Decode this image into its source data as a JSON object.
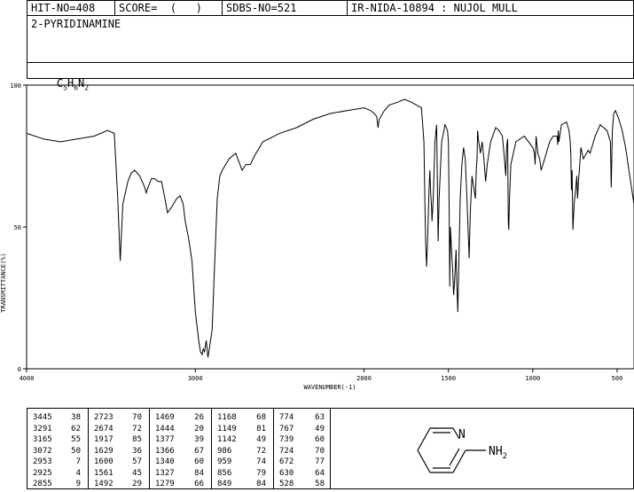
{
  "header": {
    "hit_no": "HIT-NO=408",
    "score": "SCORE=  (   )",
    "sdbs_no": "SDBS-NO=521",
    "ir_info": "IR-NIDA-10894 : NUJOL MULL",
    "compound_name": "2-PYRIDINAMINE",
    "formula": {
      "c": "C",
      "c_n": "5",
      "h": "H",
      "h_n": "6",
      "n": "N",
      "n_n": "2"
    }
  },
  "chart_data": {
    "type": "line",
    "xlabel": "WAVENUMBER(-1)",
    "ylabel": "TRANSMITTANCE(%)",
    "xlim": [
      4000,
      400
    ],
    "ylim": [
      0,
      100
    ],
    "x_ticks": [
      4000,
      3000,
      2000,
      1500,
      1000,
      500
    ],
    "y_ticks": [
      0,
      50,
      100
    ],
    "x": [
      4000,
      3900,
      3800,
      3700,
      3600,
      3520,
      3480,
      3460,
      3445,
      3430,
      3400,
      3380,
      3360,
      3330,
      3300,
      3291,
      3280,
      3260,
      3240,
      3220,
      3200,
      3180,
      3165,
      3140,
      3110,
      3090,
      3072,
      3060,
      3040,
      3020,
      3000,
      2980,
      2970,
      2960,
      2953,
      2945,
      2935,
      2925,
      2915,
      2900,
      2890,
      2870,
      2855,
      2840,
      2820,
      2800,
      2780,
      2760,
      2723,
      2700,
      2674,
      2650,
      2600,
      2500,
      2400,
      2300,
      2200,
      2100,
      2000,
      1960,
      1940,
      1925,
      1917,
      1910,
      1880,
      1850,
      1800,
      1760,
      1720,
      1690,
      1660,
      1645,
      1640,
      1635,
      1629,
      1622,
      1615,
      1610,
      1605,
      1600,
      1597,
      1590,
      1580,
      1570,
      1561,
      1555,
      1540,
      1520,
      1505,
      1500,
      1495,
      1492,
      1488,
      1480,
      1475,
      1469,
      1462,
      1455,
      1450,
      1444,
      1438,
      1430,
      1420,
      1410,
      1400,
      1390,
      1380,
      1377,
      1370,
      1360,
      1350,
      1340,
      1335,
      1330,
      1327,
      1320,
      1310,
      1300,
      1290,
      1279,
      1270,
      1250,
      1220,
      1200,
      1180,
      1168,
      1160,
      1155,
      1149,
      1145,
      1142,
      1138,
      1130,
      1100,
      1050,
      1000,
      990,
      986,
      980,
      970,
      959,
      950,
      930,
      900,
      880,
      856,
      852,
      849,
      845,
      830,
      800,
      785,
      778,
      774,
      771,
      767,
      762,
      755,
      745,
      739,
      735,
      727,
      724,
      715,
      700,
      672,
      660,
      640,
      630,
      600,
      560,
      540,
      535,
      528,
      520,
      510,
      490,
      470,
      450,
      430,
      415,
      400
    ],
    "y": [
      83,
      81,
      80,
      81,
      82,
      84,
      83,
      60,
      38,
      58,
      66,
      69,
      70,
      68,
      64,
      62,
      64,
      67,
      67,
      66,
      66,
      60,
      55,
      57,
      60,
      61,
      58,
      52,
      46,
      38,
      20,
      10,
      6,
      5,
      7,
      6,
      10,
      4,
      8,
      14,
      30,
      60,
      68,
      70,
      72,
      74,
      75,
      76,
      70,
      72,
      72,
      75,
      80,
      83,
      85,
      88,
      90,
      91,
      92,
      91,
      90,
      89,
      85,
      88,
      91,
      93,
      94,
      95,
      94,
      93,
      92,
      80,
      60,
      45,
      36,
      48,
      63,
      70,
      62,
      57,
      52,
      60,
      80,
      86,
      45,
      60,
      80,
      86,
      84,
      80,
      55,
      29,
      50,
      40,
      35,
      26,
      32,
      42,
      30,
      20,
      38,
      60,
      72,
      78,
      74,
      60,
      44,
      39,
      55,
      68,
      64,
      60,
      70,
      74,
      84,
      80,
      76,
      80,
      74,
      66,
      72,
      80,
      85,
      84,
      82,
      74,
      68,
      78,
      81,
      52,
      49,
      60,
      72,
      80,
      82,
      78,
      76,
      72,
      82,
      76,
      74,
      70,
      74,
      80,
      82,
      82,
      79,
      84,
      80,
      86,
      87,
      84,
      80,
      75,
      63,
      70,
      49,
      58,
      64,
      68,
      60,
      68,
      70,
      78,
      74,
      77,
      76,
      80,
      82,
      86,
      84,
      80,
      64,
      84,
      90,
      91,
      88,
      84,
      78,
      70,
      64,
      58
    ]
  },
  "peaks": [
    [
      [
        "3445",
        "38"
      ],
      [
        "3291",
        "62"
      ],
      [
        "3165",
        "55"
      ],
      [
        "3072",
        "50"
      ],
      [
        "2953",
        "7"
      ],
      [
        "2925",
        "4"
      ],
      [
        "2855",
        "9"
      ]
    ],
    [
      [
        "2723",
        "70"
      ],
      [
        "2674",
        "72"
      ],
      [
        "1917",
        "85"
      ],
      [
        "1629",
        "36"
      ],
      [
        "1600",
        "57"
      ],
      [
        "1561",
        "45"
      ],
      [
        "1492",
        "29"
      ]
    ],
    [
      [
        "1469",
        "26"
      ],
      [
        "1444",
        "20"
      ],
      [
        "1377",
        "39"
      ],
      [
        "1366",
        "67"
      ],
      [
        "1340",
        "60"
      ],
      [
        "1327",
        "84"
      ],
      [
        "1279",
        "66"
      ]
    ],
    [
      [
        "1168",
        "68"
      ],
      [
        "1149",
        "81"
      ],
      [
        "1142",
        "49"
      ],
      [
        "986",
        "72"
      ],
      [
        "959",
        "74"
      ],
      [
        "856",
        "79"
      ],
      [
        "849",
        "84"
      ]
    ],
    [
      [
        "774",
        "63"
      ],
      [
        "767",
        "49"
      ],
      [
        "739",
        "60"
      ],
      [
        "724",
        "70"
      ],
      [
        "672",
        "77"
      ],
      [
        "630",
        "64"
      ],
      [
        "528",
        "58"
      ]
    ]
  ],
  "structure": {
    "n_label": "N",
    "nh2_label": "NH",
    "nh2_sub": "2"
  }
}
